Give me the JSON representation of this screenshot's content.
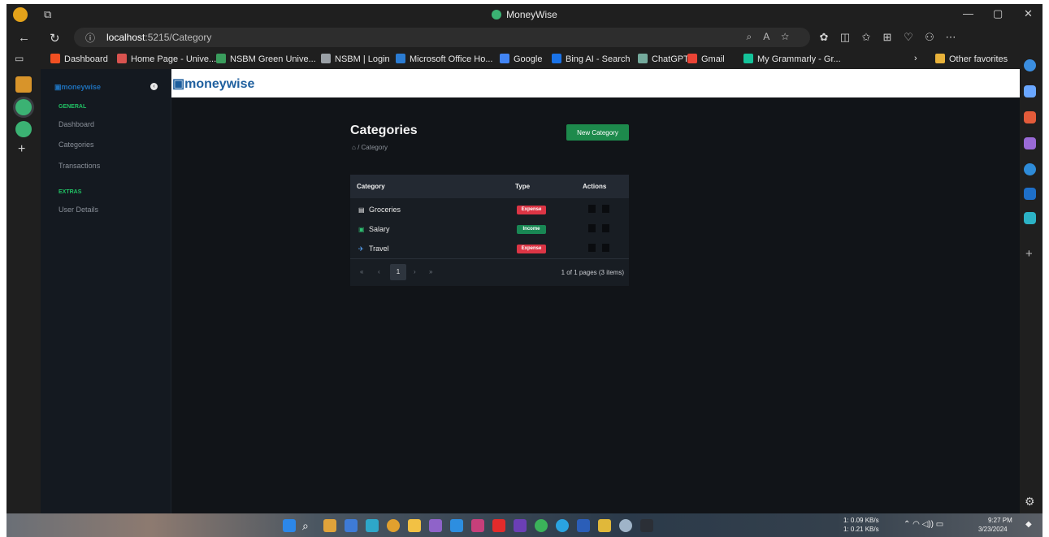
{
  "browser": {
    "window_title": "MoneyWise",
    "url_host": "localhost",
    "url_rest": ":5215/Category",
    "favorites": [
      {
        "label": "Dashboard",
        "color": "#f25022"
      },
      {
        "label": "Home Page - Unive...",
        "color": "#d9534f"
      },
      {
        "label": "NSBM Green Unive...",
        "color": "#3a9d5d"
      },
      {
        "label": "NSBM | Login",
        "color": "#9aa0a6"
      },
      {
        "label": "Microsoft Office Ho...",
        "color": "#2b7cd3"
      },
      {
        "label": "Google",
        "color": "#4285f4"
      },
      {
        "label": "Bing AI - Search",
        "color": "#1a73e8"
      },
      {
        "label": "ChatGPT",
        "color": "#74aa9c"
      },
      {
        "label": "Gmail",
        "color": "#ea4335"
      },
      {
        "label": "My Grammarly - Gr...",
        "color": "#15c39a"
      }
    ],
    "other_favorites": "Other favorites"
  },
  "sidebar": {
    "logo": "moneywise",
    "sections": [
      {
        "heading": "GENERAL",
        "items": [
          "Dashboard",
          "Categories",
          "Transactions"
        ]
      },
      {
        "heading": "EXTRAS",
        "items": [
          "User Details"
        ]
      }
    ]
  },
  "header": {
    "logo": "moneywise"
  },
  "page": {
    "title": "Categories",
    "breadcrumb": "/ Category",
    "new_button": "New Category"
  },
  "table": {
    "columns": [
      "Category",
      "Type",
      "Actions"
    ],
    "rows": [
      {
        "icon": "▤",
        "name": "Groceries",
        "type": "Expense",
        "type_color": "#dc3545"
      },
      {
        "icon": "▣",
        "name": "Salary",
        "type": "Income",
        "type_color": "#198754"
      },
      {
        "icon": "✈",
        "name": "Travel",
        "type": "Expense",
        "type_color": "#dc3545"
      }
    ],
    "pager": {
      "first": "«",
      "prev": "‹",
      "current": "1",
      "next": "›",
      "last": "»",
      "summary": "1 of 1 pages (3 items)"
    }
  },
  "taskbar": {
    "net_up": "1: 0.09 KB/s",
    "net_down": "1: 0.21 KB/s",
    "time": "9:27 PM",
    "date": "3/23/2024"
  }
}
